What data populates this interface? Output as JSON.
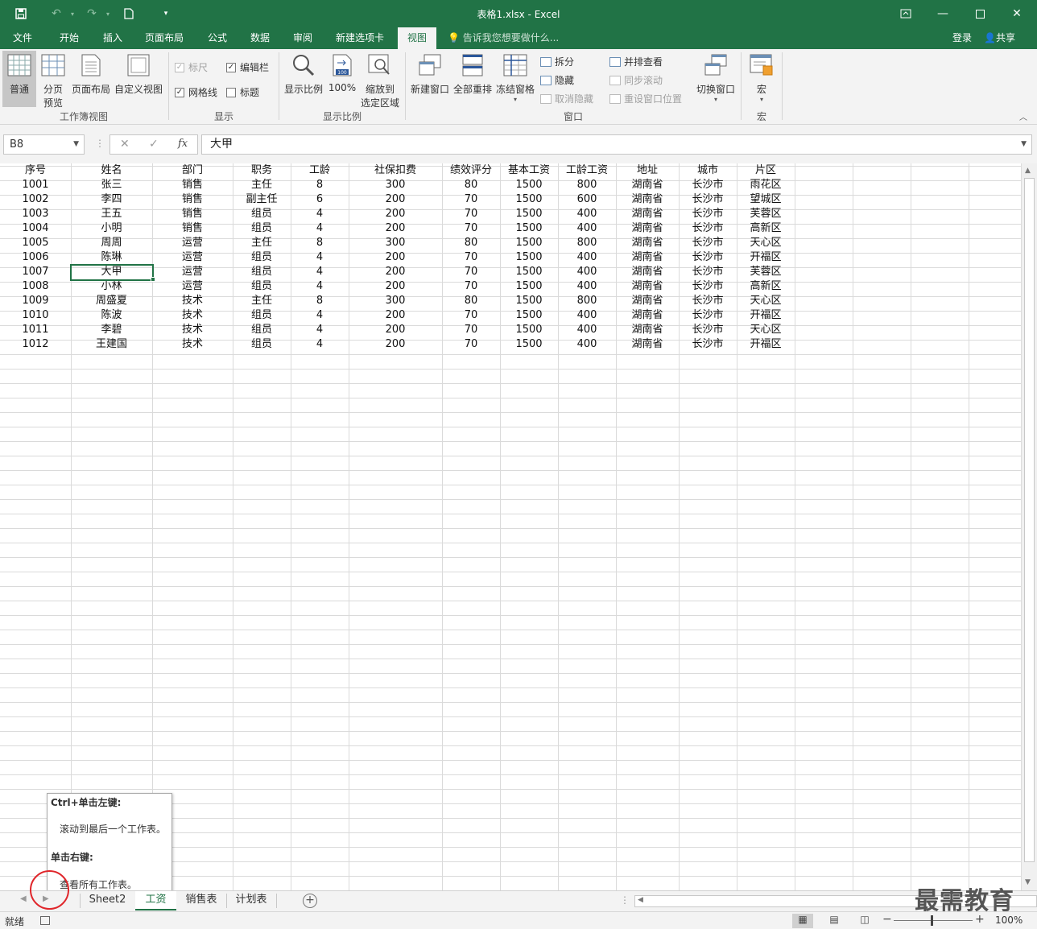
{
  "window": {
    "title": "表格1.xlsx - Excel",
    "accent": "#217346"
  },
  "menu": {
    "tabs": [
      "文件",
      "开始",
      "插入",
      "页面布局",
      "公式",
      "数据",
      "审阅",
      "新建选项卡",
      "视图"
    ],
    "active_tab": "视图",
    "tell_me": "告诉我您想要做什么...",
    "login": "登录",
    "share": "共享"
  },
  "ribbon": {
    "workbook_views": {
      "label": "工作簿视图",
      "normal": "普通",
      "page_break_line1": "分页",
      "page_break_line2": "预览",
      "page_layout": "页面布局",
      "custom_views": "自定义视图"
    },
    "show": {
      "label": "显示",
      "ruler": "标尺",
      "formula_bar": "编辑栏",
      "gridlines": "网格线",
      "headings": "标题"
    },
    "zoom": {
      "label": "显示比例",
      "zoom": "显示比例",
      "hundred": "100%",
      "zoom_sel_line1": "缩放到",
      "zoom_sel_line2": "选定区域",
      "icon_badge": "100"
    },
    "window": {
      "label": "窗口",
      "new_window": "新建窗口",
      "arrange_all": "全部重排",
      "freeze_panes": "冻结窗格",
      "split": "拆分",
      "hide": "隐藏",
      "unhide": "取消隐藏",
      "side_by_side": "并排查看",
      "sync_scroll": "同步滚动",
      "reset_position": "重设窗口位置",
      "switch_windows": "切换窗口"
    },
    "macros": {
      "label": "宏",
      "macros": "宏"
    }
  },
  "formula_bar": {
    "name_box": "B8",
    "fx": "fx",
    "value": "大甲"
  },
  "sheet": {
    "headers": [
      "序号",
      "姓名",
      "部门",
      "职务",
      "工龄",
      "社保扣费",
      "绩效评分",
      "基本工资",
      "工龄工资",
      "地址",
      "城市",
      "片区"
    ],
    "rows": [
      [
        "1001",
        "张三",
        "销售",
        "主任",
        "8",
        "300",
        "80",
        "1500",
        "800",
        "湖南省",
        "长沙市",
        "雨花区"
      ],
      [
        "1002",
        "李四",
        "销售",
        "副主任",
        "6",
        "200",
        "70",
        "1500",
        "600",
        "湖南省",
        "长沙市",
        "望城区"
      ],
      [
        "1003",
        "王五",
        "销售",
        "组员",
        "4",
        "200",
        "70",
        "1500",
        "400",
        "湖南省",
        "长沙市",
        "芙蓉区"
      ],
      [
        "1004",
        "小明",
        "销售",
        "组员",
        "4",
        "200",
        "70",
        "1500",
        "400",
        "湖南省",
        "长沙市",
        "高新区"
      ],
      [
        "1005",
        "周周",
        "运营",
        "主任",
        "8",
        "300",
        "80",
        "1500",
        "800",
        "湖南省",
        "长沙市",
        "天心区"
      ],
      [
        "1006",
        "陈琳",
        "运营",
        "组员",
        "4",
        "200",
        "70",
        "1500",
        "400",
        "湖南省",
        "长沙市",
        "开福区"
      ],
      [
        "1007",
        "大甲",
        "运营",
        "组员",
        "4",
        "200",
        "70",
        "1500",
        "400",
        "湖南省",
        "长沙市",
        "芙蓉区"
      ],
      [
        "1008",
        "小林",
        "运营",
        "组员",
        "4",
        "200",
        "70",
        "1500",
        "400",
        "湖南省",
        "长沙市",
        "高新区"
      ],
      [
        "1009",
        "周盛夏",
        "技术",
        "主任",
        "8",
        "300",
        "80",
        "1500",
        "800",
        "湖南省",
        "长沙市",
        "天心区"
      ],
      [
        "1010",
        "陈波",
        "技术",
        "组员",
        "4",
        "200",
        "70",
        "1500",
        "400",
        "湖南省",
        "长沙市",
        "开福区"
      ],
      [
        "1011",
        "李碧",
        "技术",
        "组员",
        "4",
        "200",
        "70",
        "1500",
        "400",
        "湖南省",
        "长沙市",
        "天心区"
      ],
      [
        "1012",
        "王建国",
        "技术",
        "组员",
        "4",
        "200",
        "70",
        "1500",
        "400",
        "湖南省",
        "长沙市",
        "开福区"
      ]
    ]
  },
  "tooltip": {
    "title1": "Ctrl+单击左键:",
    "desc1": "滚动到最后一个工作表。",
    "title2": "单击右键:",
    "desc2": "查看所有工作表。"
  },
  "sheet_tabs": {
    "tabs": [
      "Sheet2",
      "工资",
      "销售表",
      "计划表"
    ],
    "active": "工资"
  },
  "status": {
    "ready": "就绪",
    "zoom": "100%"
  },
  "watermark": "最需教育"
}
